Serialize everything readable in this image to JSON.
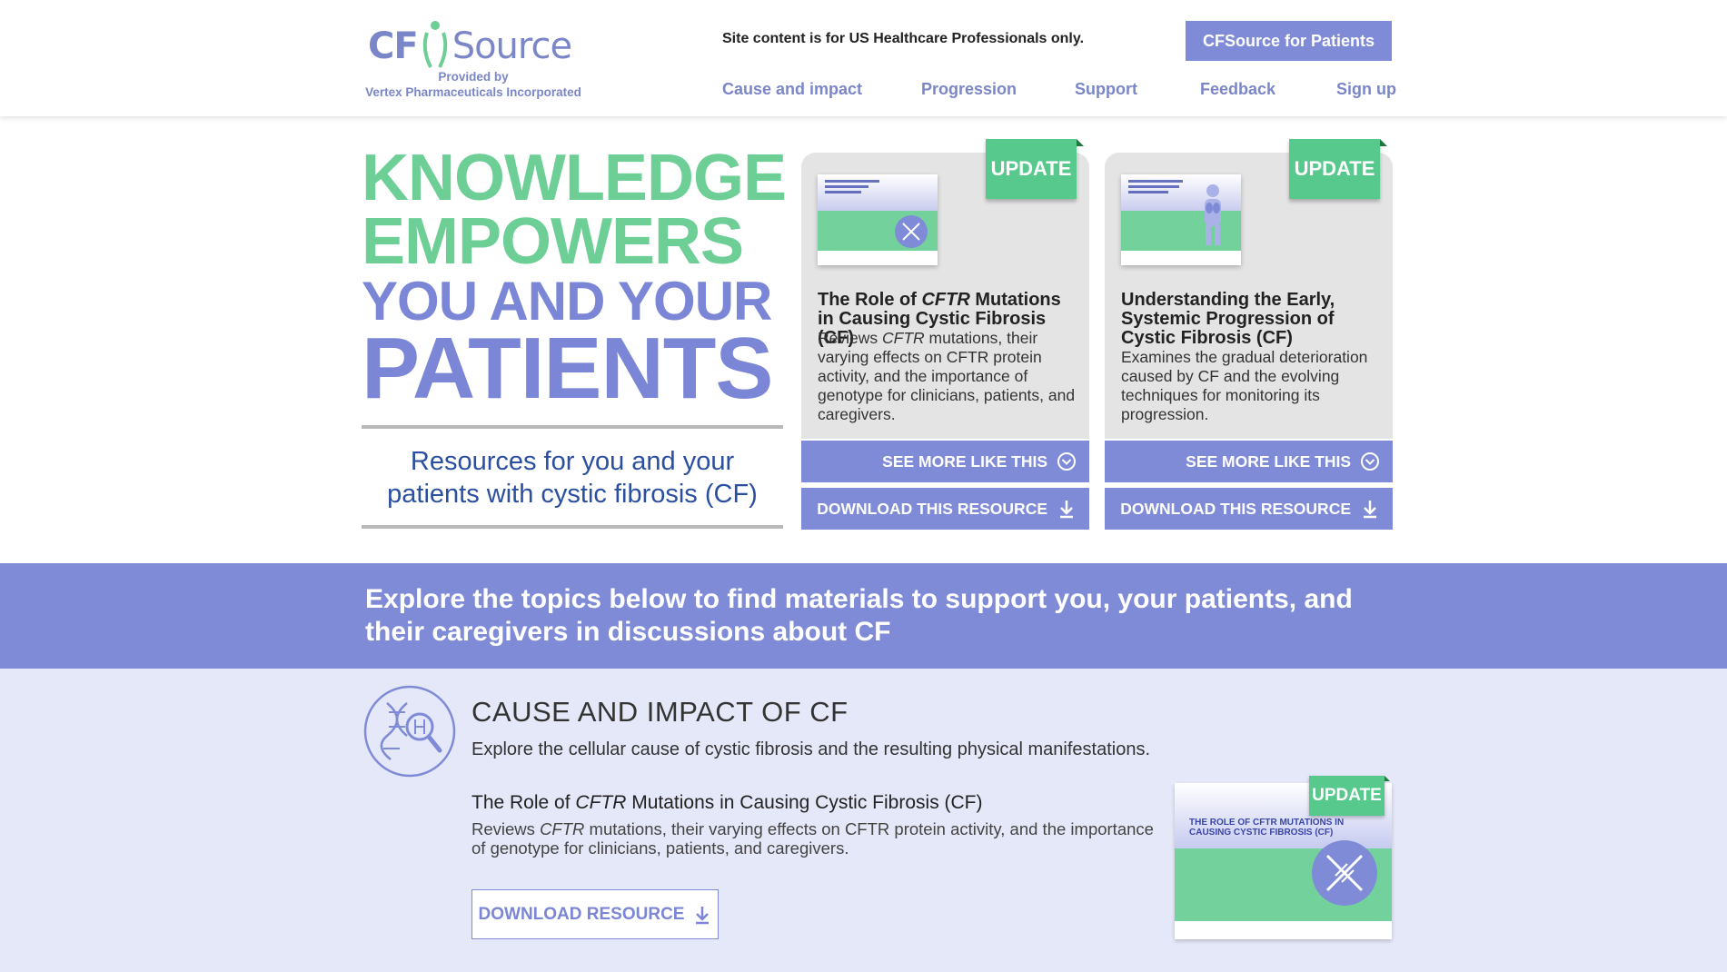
{
  "header": {
    "logo": {
      "cf": "CF",
      "source": "Source",
      "provided_by": "Provided by",
      "company": "Vertex Pharmaceuticals Incorporated"
    },
    "hcp_note": "Site content is for US Healthcare Professionals only.",
    "patients_button": "CFSource for Patients",
    "nav": [
      {
        "label": "Cause and impact"
      },
      {
        "label": "Progression"
      },
      {
        "label": "Support"
      },
      {
        "label": "Feedback"
      },
      {
        "label": "Sign up"
      }
    ]
  },
  "hero": {
    "line1": "KNOWLEDGE",
    "line2": "EMPOWERS",
    "line3": "YOU AND YOUR",
    "line4": "PATIENTS",
    "subtitle": "Resources for you and your patients with cystic fibrosis (CF)"
  },
  "cards": [
    {
      "badge": "UPDATE",
      "title_prefix": "The Role of ",
      "title_em": "CFTR",
      "title_suffix": " Mutations in Causing Cystic Fibrosis (CF)",
      "desc_prefix": "Reviews ",
      "desc_em": "CFTR",
      "desc_suffix": " mutations, their varying effects on CFTR protein activity, and the importance of genotype for clinicians, patients, and caregivers.",
      "see_more": "SEE MORE LIKE THIS",
      "download": "DOWNLOAD THIS RESOURCE"
    },
    {
      "badge": "UPDATE",
      "title": "Understanding the Early, Systemic Progression of Cystic Fibrosis (CF)",
      "desc": "Examines the gradual deterioration caused by CF and the evolving techniques for monitoring its progression.",
      "see_more": "SEE MORE LIKE THIS",
      "download": "DOWNLOAD THIS RESOURCE"
    }
  ],
  "band": {
    "text": "Explore the topics below to find materials to support you, your patients, and their caregivers in discussions about CF"
  },
  "section": {
    "title": "CAUSE AND IMPACT OF CF",
    "subtitle": "Explore the cellular cause of cystic fibrosis and the resulting physical manifestations.",
    "resource": {
      "title_prefix": "The Role of ",
      "title_em": "CFTR",
      "title_suffix": " Mutations in Causing Cystic Fibrosis (CF)",
      "desc_prefix": "Reviews ",
      "desc_em": "CFTR",
      "desc_suffix": " mutations, their varying effects on CFTR protein activity, and the importance of genotype for clinicians, patients, and caregivers.",
      "download": "DOWNLOAD RESOURCE",
      "badge": "UPDATE",
      "thumb_text": "THE ROLE OF CFTR MUTATIONS IN CAUSING CYSTIC FIBROSIS (CF)"
    }
  },
  "colors": {
    "accent_purple": "#7f8bd6",
    "accent_green": "#6dcf96",
    "section_bg": "#e5e8f8"
  }
}
